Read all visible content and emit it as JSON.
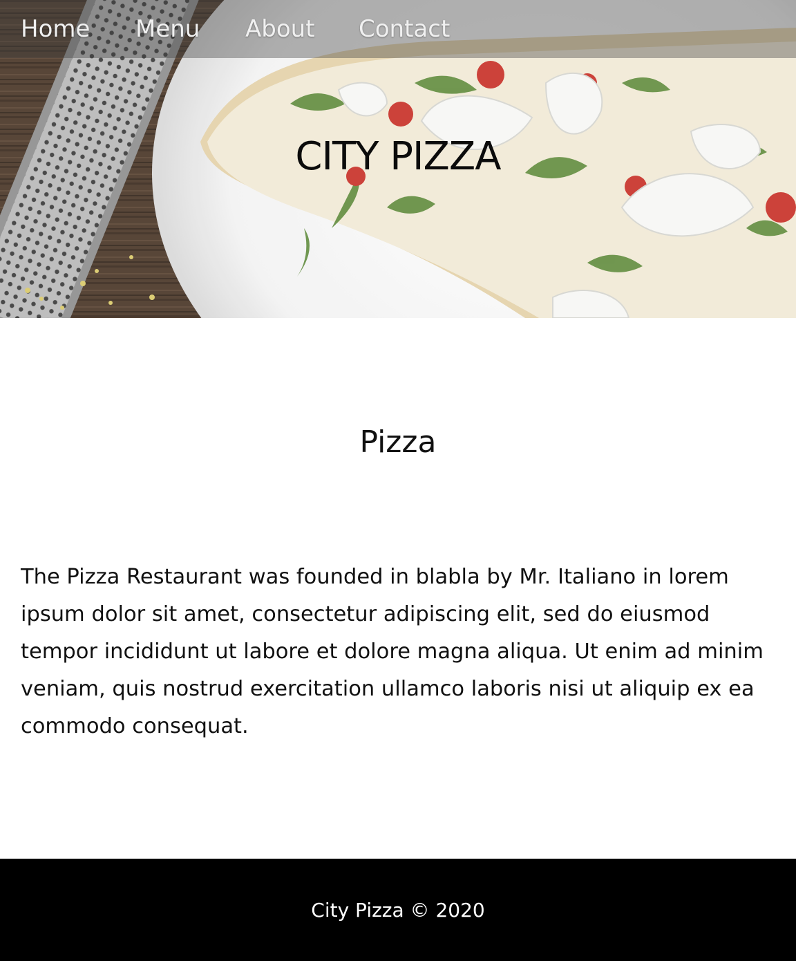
{
  "nav": {
    "items": [
      {
        "label": "Home"
      },
      {
        "label": "Menu"
      },
      {
        "label": "About"
      },
      {
        "label": "Contact"
      }
    ]
  },
  "hero": {
    "title": "CITY PIZZA",
    "image": "pizza-on-plate-photo"
  },
  "main": {
    "heading": "Pizza",
    "paragraph": "The Pizza Restaurant was founded in blabla by Mr. Italiano in lorem ipsum dolor sit amet, consectetur adipiscing elit, sed do eiusmod tempor incididunt ut labore et dolore magna aliqua. Ut enim ad minim veniam, quis nostrud exercitation ullamco laboris nisi ut aliquip ex ea commodo consequat."
  },
  "footer": {
    "text": "City Pizza © 2020"
  },
  "colors": {
    "navbar_overlay": "#3c3c3c",
    "footer_bg": "#000000",
    "footer_text": "#ffffff",
    "body_text": "#111111"
  }
}
